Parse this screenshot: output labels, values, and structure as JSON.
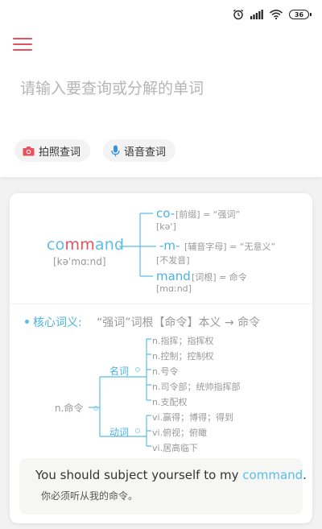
{
  "status_bar": {
    "icons": [
      "alarm-icon",
      "signal-icon",
      "wifi-icon",
      "battery-icon"
    ],
    "battery": "36"
  },
  "header": {
    "menu_icon": "hamburger-menu-icon",
    "search": {
      "placeholder": "请输入要查询或分解的单词",
      "value": ""
    },
    "photo_button": {
      "icon": "camera-icon",
      "label": "拍照查词"
    },
    "voice_button": {
      "icon": "microphone-icon",
      "label": "语音查词"
    }
  },
  "word_card": {
    "word": {
      "before": "co",
      "highlight": "mm",
      "after": "and",
      "phonetic": "[kəˈmɑːnd]"
    },
    "parts": [
      {
        "text": "co-",
        "note": "[前缀] = “强词”",
        "pron": "[kə']"
      },
      {
        "text": "-m-",
        "note": "[辅音字母] = “无意义”",
        "pron": "[不发音]"
      },
      {
        "text": "mand",
        "note": "[词根] = 命令",
        "pron": "[mɑːnd]"
      }
    ],
    "core_meaning": {
      "label": "核心词义:",
      "text": "“强词”词根【命令】本义 → 命令"
    },
    "tree": {
      "root": "n.命令",
      "noun": {
        "label": "名词",
        "senses": [
          "n.指挥；指挥权",
          "n.控制；控制权",
          "n.号令",
          "n.司令部；统帅指挥部",
          "n.支配权"
        ]
      },
      "verb": {
        "label": "动词",
        "senses": [
          "vi.赢得；博得；得到",
          "vi.俯视；俯瞰",
          "vi.居高临下"
        ]
      }
    },
    "example": {
      "en_before": "You should subject yourself to my ",
      "en_keyword": "command",
      "en_after": ".",
      "cn": "你必须听从我的命令。"
    }
  },
  "colors": {
    "accent_red": "#e8505b",
    "accent_blue": "#5bbde8"
  }
}
